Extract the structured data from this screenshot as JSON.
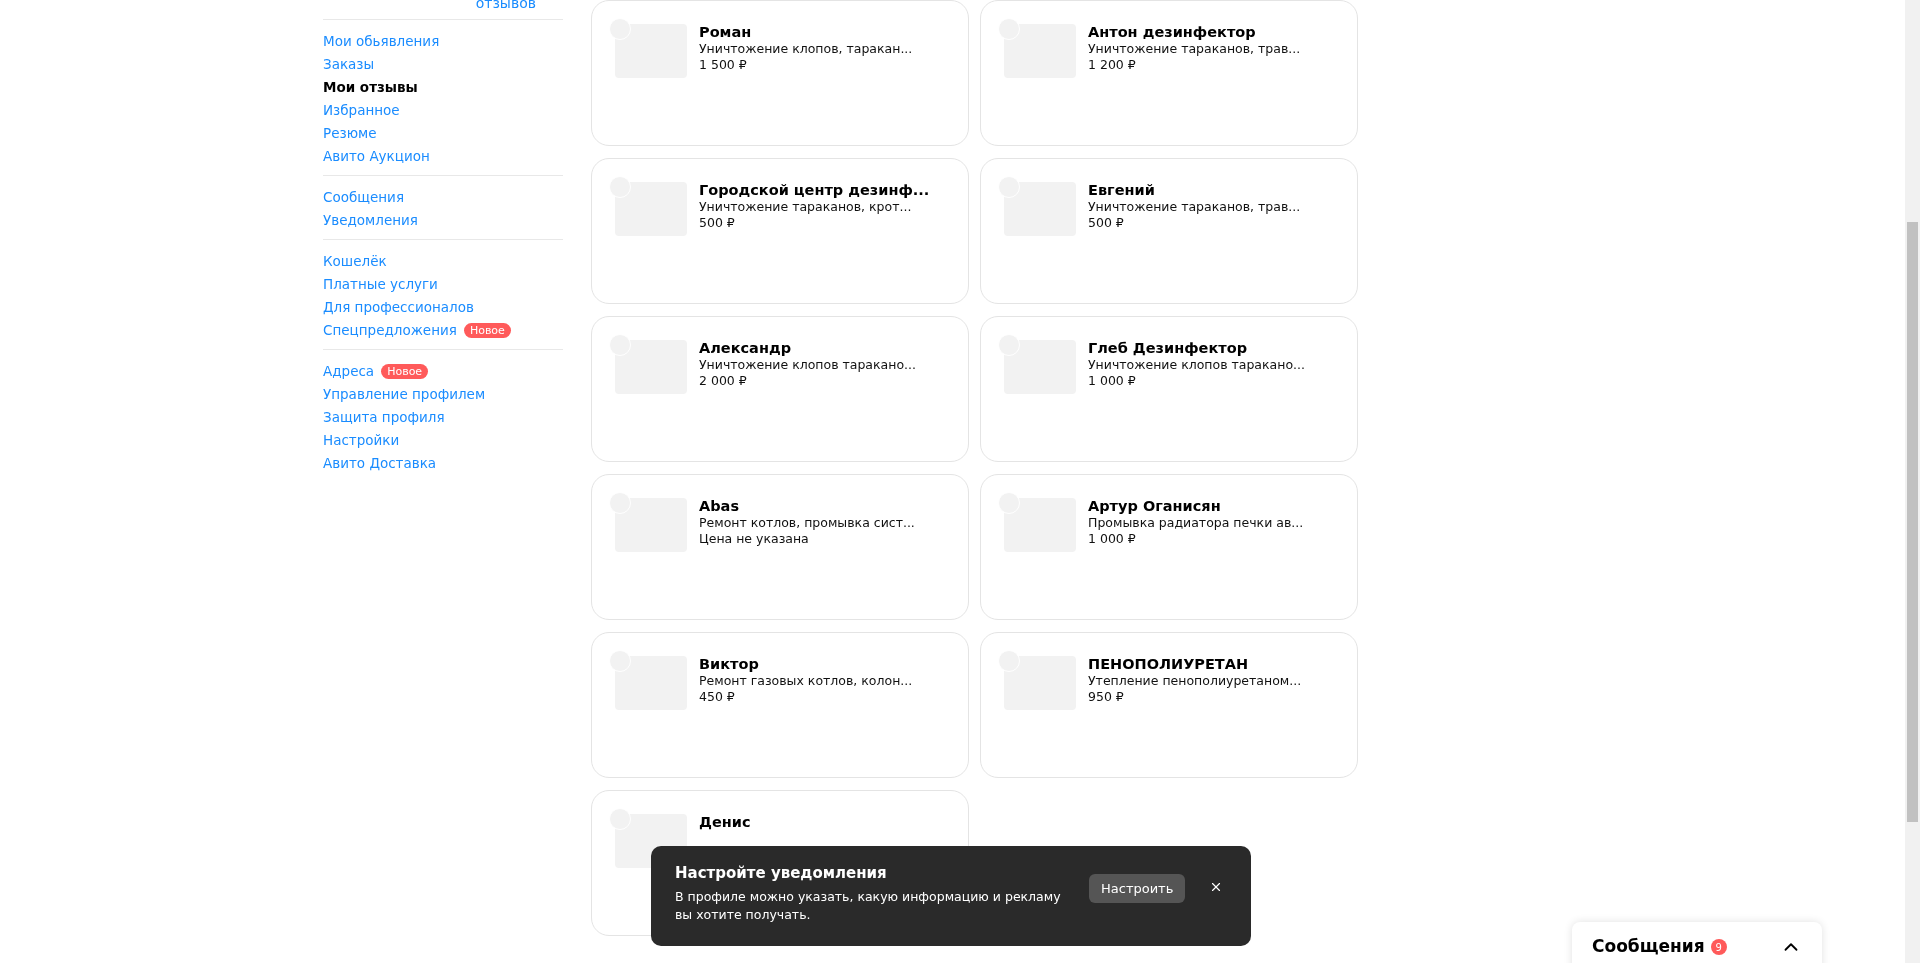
{
  "sidebar": {
    "header_link": "отзывов",
    "groups": [
      {
        "items": [
          {
            "label": "Мои обьявления",
            "selected": false
          },
          {
            "label": "Заказы",
            "selected": false
          },
          {
            "label": "Мои отзывы",
            "selected": true
          },
          {
            "label": "Избранное",
            "selected": false
          },
          {
            "label": "Резюме",
            "selected": false
          },
          {
            "label": "Авито Аукцион",
            "selected": false
          }
        ]
      },
      {
        "items": [
          {
            "label": "Сообщения",
            "selected": false
          },
          {
            "label": "Уведомления",
            "selected": false
          }
        ]
      },
      {
        "items": [
          {
            "label": "Кошелёк",
            "selected": false
          },
          {
            "label": "Платные услуги",
            "selected": false
          },
          {
            "label": "Для профессионалов",
            "selected": false
          },
          {
            "label": "Спецпредложения",
            "selected": false,
            "badge": "Новое"
          }
        ]
      },
      {
        "items": [
          {
            "label": "Адреса",
            "selected": false,
            "badge": "Новое"
          },
          {
            "label": "Управление профилем",
            "selected": false
          },
          {
            "label": "Защита профиля",
            "selected": false
          },
          {
            "label": "Настройки",
            "selected": false
          },
          {
            "label": "Авито Доставка",
            "selected": false
          }
        ]
      }
    ]
  },
  "cards": [
    {
      "name": "Роман",
      "description": "Уничтожение клопов, таракан...",
      "price": "1 500 ₽"
    },
    {
      "name": "Антон дезинфектор",
      "description": "Уничтожение тараканов, трав...",
      "price": "1 200 ₽"
    },
    {
      "name": "Городской центр дезинф...",
      "description": "Уничтожение тараканов, крот...",
      "price": "500 ₽"
    },
    {
      "name": "Евгений",
      "description": "Уничтожение тараканов, трав...",
      "price": "500 ₽"
    },
    {
      "name": "Александр",
      "description": "Уничтожение клопов таракано...",
      "price": "2 000 ₽"
    },
    {
      "name": "Глеб Дезинфектор",
      "description": "Уничтожение клопов таракано...",
      "price": "1 000 ₽"
    },
    {
      "name": "Abas",
      "description": "Ремонт котлов, промывка сист...",
      "price": "Цена не указана"
    },
    {
      "name": "Артур Оганисян",
      "description": "Промывка радиатора печки ав...",
      "price": "1 000 ₽"
    },
    {
      "name": "Виктор",
      "description": "Ремонт газовых котлов, колон...",
      "price": "450 ₽"
    },
    {
      "name": "ПЕНОПОЛИУРЕТАН",
      "description": "Утепление пенополиуретаном...",
      "price": "950 ₽"
    },
    {
      "name": "Денис"
    }
  ],
  "toast": {
    "title": "Настройте уведомления",
    "text": "В профиле можно указать, какую информацию и рекламу вы хотите получать.",
    "button": "Настроить"
  },
  "messages_widget": {
    "label": "Сообщения",
    "count": "9"
  }
}
